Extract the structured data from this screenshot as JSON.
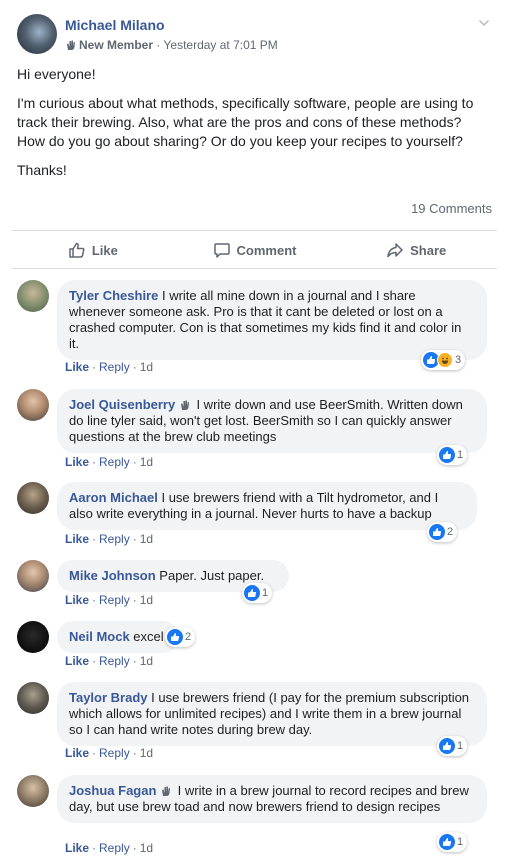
{
  "post": {
    "author": "Michael Milano",
    "badge": "New Member",
    "separator": "·",
    "time": "Yesterday at 7:01 PM",
    "paragraphs": [
      "Hi everyone!",
      "I'm curious about what methods, specifically software, people are using to track their brewing. Also, what are the pros and cons of these methods? How do you go about sharing? Or do you keep your recipes to yourself?",
      "Thanks!"
    ],
    "comments_count": "19 Comments",
    "actions": {
      "like": "Like",
      "comment": "Comment",
      "share": "Share"
    }
  },
  "comments": [
    {
      "name": "Tyler Cheshire",
      "text": " I write all mine down in a journal and I share whenever someone ask. Pro is that it cant be deleted or lost on a crashed computer. Con is that sometimes my kids find it and color in it.",
      "reactions": "3",
      "like": "Like",
      "reply": "Reply",
      "age": "1d"
    },
    {
      "name": "Joel Quisenberry",
      "text": " I write down and use BeerSmith. Written down do line tyler said, won't get lost. BeerSmith so I can quickly answer questions at the brew club meetings",
      "reactions": "1",
      "like": "Like",
      "reply": "Reply",
      "age": "1d"
    },
    {
      "name": "Aaron Michael",
      "text": " I use brewers friend with a Tilt hydrometor, and I also write everything in a journal. Never hurts to have a backup",
      "reactions": "2",
      "like": "Like",
      "reply": "Reply",
      "age": "1d"
    },
    {
      "name": "Mike Johnson",
      "text": " Paper. Just paper.",
      "reactions": "1",
      "like": "Like",
      "reply": "Reply",
      "age": "1d"
    },
    {
      "name": "Neil Mock",
      "text": " excel",
      "reactions": "2",
      "like": "Like",
      "reply": "Reply",
      "age": "1d"
    },
    {
      "name": "Taylor Brady",
      "text": " I use brewers friend (I pay for the premium subscription which allows for unlimited recipes) and I write them in a brew journal so I can hand write notes during brew day.",
      "reactions": "1",
      "like": "Like",
      "reply": "Reply",
      "age": "1d"
    },
    {
      "name": "Joshua Fagan",
      "text": " I write in a brew journal to record recipes and brew day, but use brew toad and now brewers friend to design recipes",
      "reactions": "1",
      "like": "Like",
      "reply": "Reply",
      "age": "1d"
    }
  ],
  "colors": {
    "link": "#385898",
    "muted": "#606770",
    "bubble": "#f2f3f5",
    "like_blue": "#1877f2",
    "haha_yellow": "#f7b125"
  },
  "icons": [
    "new-member-wave-icon",
    "chevron-down-icon",
    "thumbs-up-icon",
    "comment-icon",
    "share-arrow-icon",
    "like-reaction-icon",
    "haha-reaction-icon"
  ]
}
